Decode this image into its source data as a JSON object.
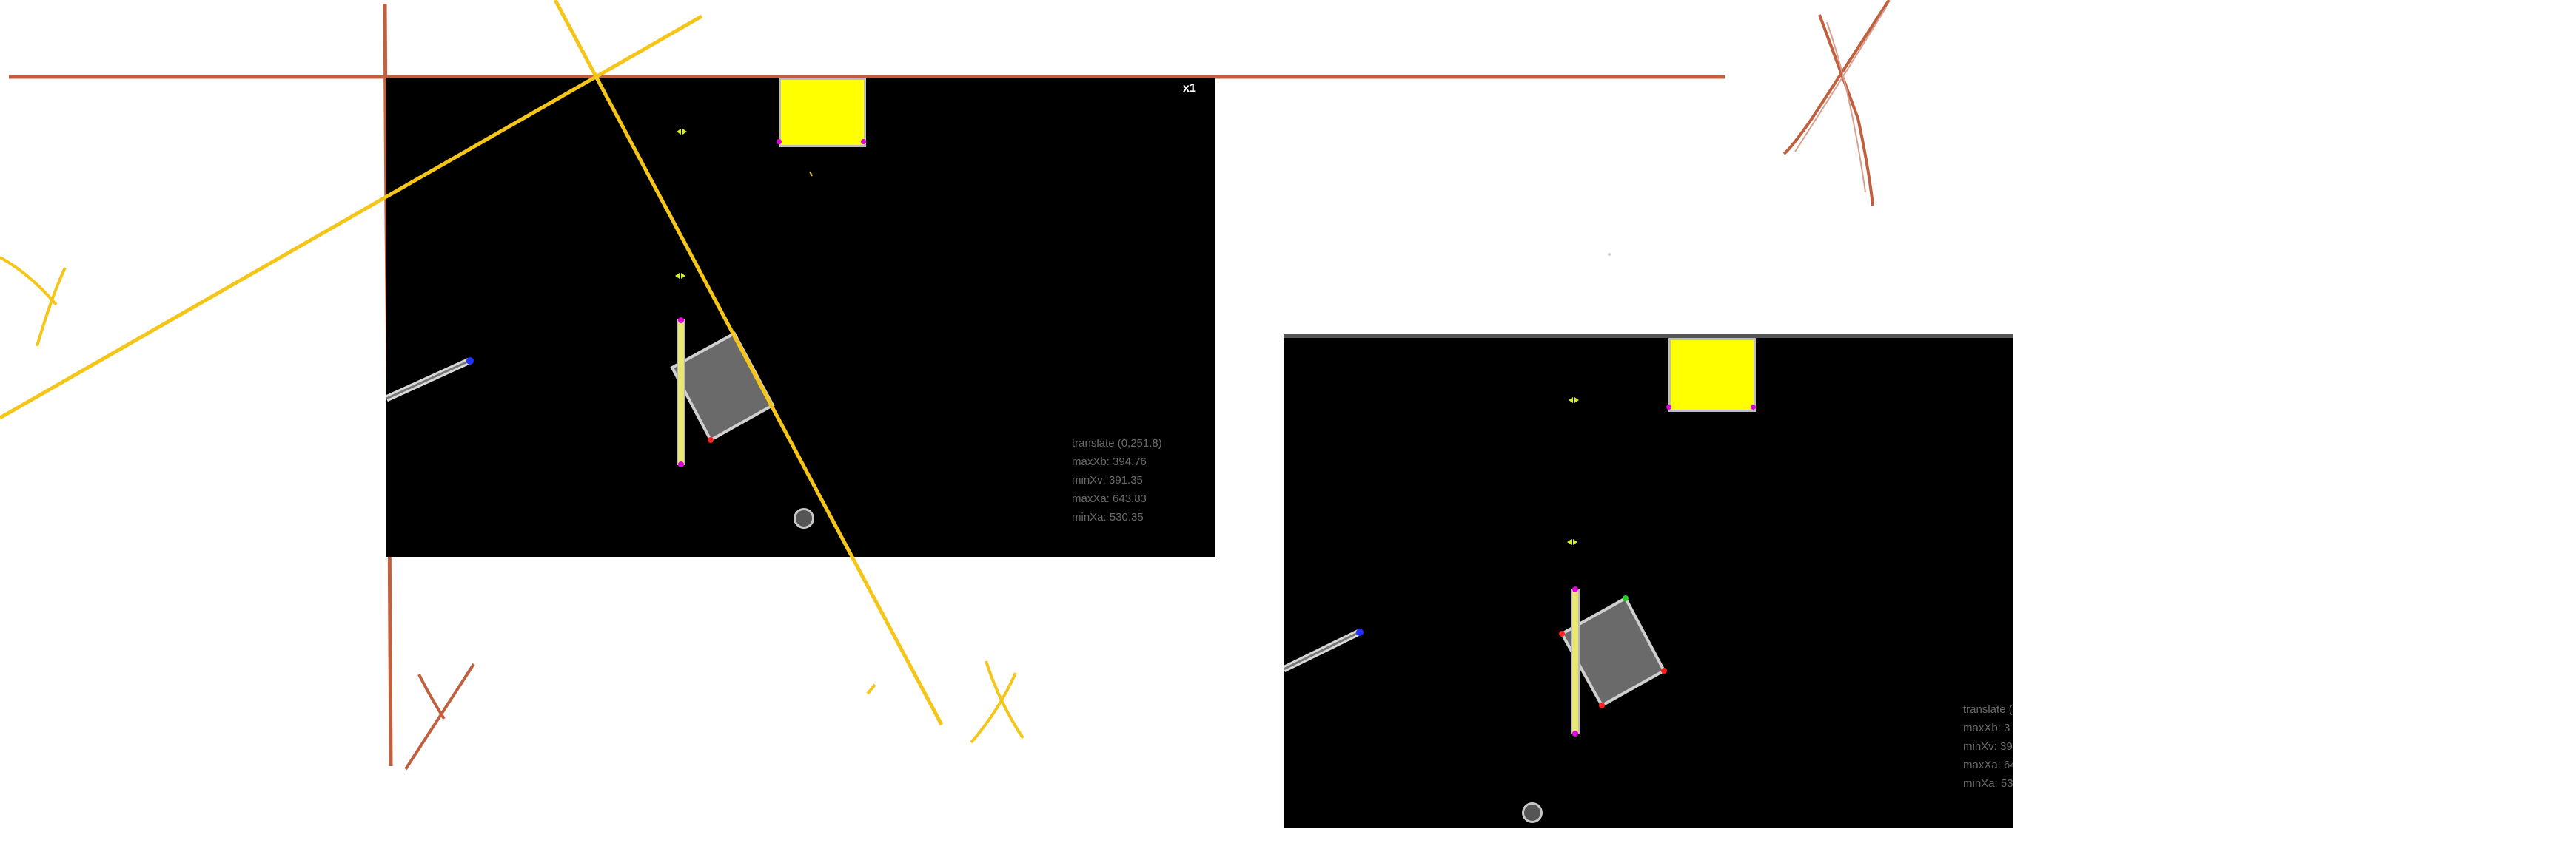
{
  "scene1": {
    "zoom_label": "x1",
    "info": {
      "translate": "translate (0,251.8)",
      "maxXb": "maxXb: 394.76",
      "minXv": "minXv: 391.35",
      "maxXa": "maxXa: 643.83",
      "minXa": "minXa: 530.35"
    }
  },
  "scene2": {
    "info": {
      "translate": "translate (",
      "maxXb": "maxXb: 3",
      "minXv": "minXv: 39",
      "maxXa": "maxXa: 64",
      "minXa": "minXa: 53"
    }
  },
  "colors": {
    "orange_line": "#c0603e",
    "yellow_line": "#f5c518",
    "yellow_box": "#ffff00",
    "gray_box": "#6a6a6a",
    "magenta": "#e000e0",
    "blue": "#2030ff",
    "green": "#20d020",
    "red": "#ff2020"
  },
  "icons": [
    "knob-icon",
    "double-arrow-icon"
  ]
}
